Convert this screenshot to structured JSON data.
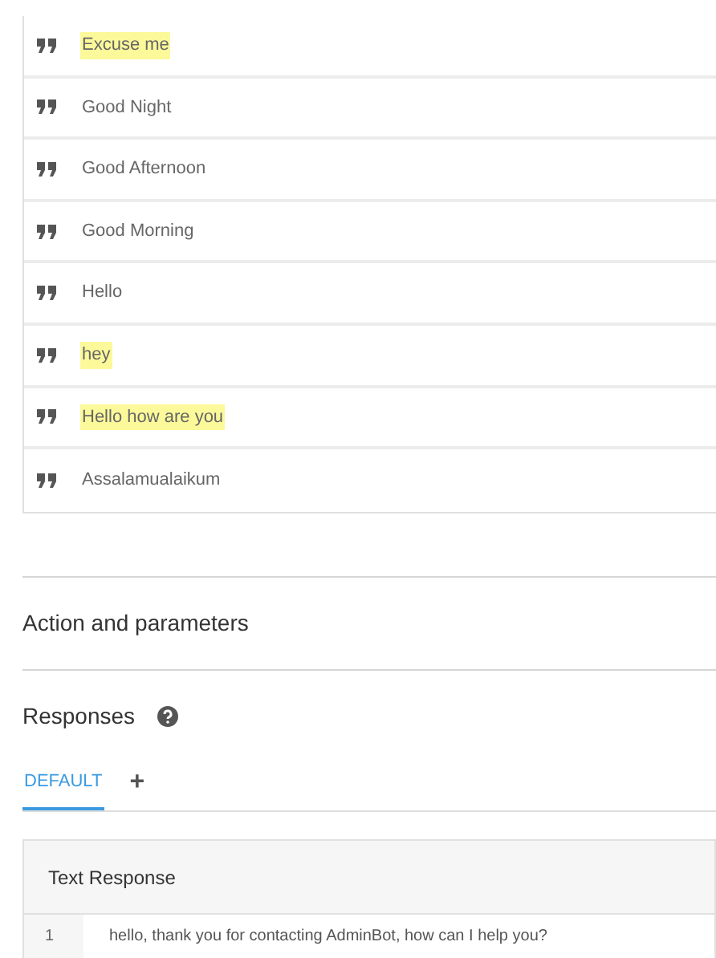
{
  "phrases": [
    {
      "text": "Excuse me",
      "highlighted": true
    },
    {
      "text": "Good Night",
      "highlighted": false
    },
    {
      "text": "Good Afternoon",
      "highlighted": false
    },
    {
      "text": "Good Morning",
      "highlighted": false
    },
    {
      "text": "Hello",
      "highlighted": false
    },
    {
      "text": "hey",
      "highlighted": true
    },
    {
      "text": "Hello how are you",
      "highlighted": true
    },
    {
      "text": "Assalamualaikum",
      "highlighted": false
    }
  ],
  "action_section": {
    "title": "Action and parameters"
  },
  "responses": {
    "title": "Responses",
    "tabs": [
      {
        "label": "DEFAULT",
        "selected": true
      }
    ],
    "add_tab": "+",
    "table": {
      "title": "Text Response",
      "rows": [
        {
          "number": "1",
          "text": "hello, thank you for contacting AdminBot, how can I help you?"
        }
      ]
    }
  }
}
